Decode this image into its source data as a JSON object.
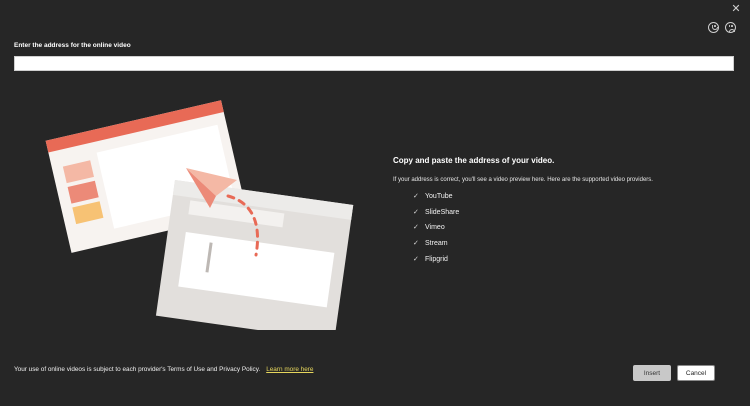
{
  "dialog": {
    "close_icon": "close-icon",
    "feedback_icons": [
      "smile-icon",
      "frown-icon"
    ]
  },
  "url": {
    "label": "Enter the address for the online video",
    "value": "",
    "placeholder": ""
  },
  "info": {
    "title": "Copy and paste the address of your video.",
    "description": "If your address is correct, you'll see a video preview here. Here are the supported video providers.",
    "providers": [
      "YouTube",
      "SlideShare",
      "Vimeo",
      "Stream",
      "Flipgrid"
    ]
  },
  "footer": {
    "text": "Your use of online videos is subject to each provider's Terms of Use and Privacy Policy.",
    "learn_more": "Learn more here"
  },
  "buttons": {
    "insert": "Insert",
    "cancel": "Cancel"
  },
  "colors": {
    "background": "#262626",
    "accent": "#e86a56",
    "link": "#e6d65c"
  }
}
